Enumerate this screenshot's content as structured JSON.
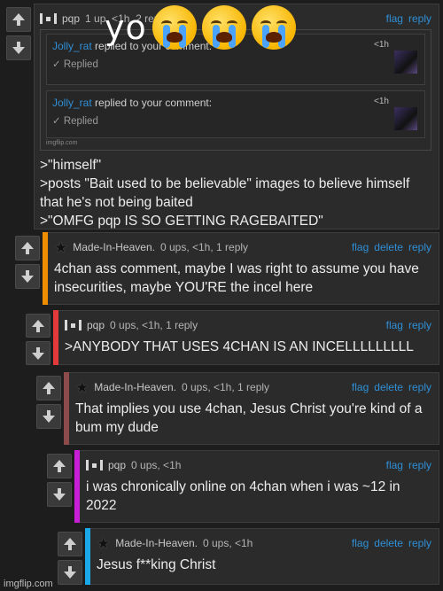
{
  "caption": {
    "text": "yo",
    "emoji_count": 3,
    "emoji_name": "loudly-crying-face"
  },
  "colors": {
    "accent_link": "#2f8fd6",
    "bar_orange": "#f08c00",
    "bar_red": "#e23a3a",
    "bar_brown": "#8c4a4a",
    "bar_magenta": "#c81ed6",
    "bar_cyan": "#1aa8e8"
  },
  "comments": [
    {
      "user": "pqp",
      "stats": "1 up, <1h, 2 replies",
      "actions": [
        "flag",
        "reply"
      ],
      "embed": {
        "notifications": [
          {
            "who": "Jolly_rat",
            "text": " replied to your comment:",
            "time": "<1h",
            "status": "Replied"
          },
          {
            "who": "Jolly_rat",
            "text": " replied to your comment:",
            "time": "<1h",
            "status": "Replied"
          }
        ],
        "watermark": "imgflip.com"
      },
      "lines": [
        ">\"himself\"",
        ">posts \"Bait used to be believable\" images to believe himself that he's not being baited",
        ">\"OMFG pqp IS SO GETTING RAGEBAITED\""
      ]
    },
    {
      "user": "Made-In-Heaven.",
      "stats": "0 ups, <1h, 1 reply",
      "actions": [
        "flag",
        "delete",
        "reply"
      ],
      "text": "4chan ass comment, maybe I was right to assume you have insecurities, maybe YOU'RE the incel here"
    },
    {
      "user": "pqp",
      "stats": "0 ups, <1h, 1 reply",
      "actions": [
        "flag",
        "reply"
      ],
      "text": ">ANYBODY THAT USES 4CHAN IS AN INCELLLLLLLLL"
    },
    {
      "user": "Made-In-Heaven.",
      "stats": "0 ups, <1h, 1 reply",
      "actions": [
        "flag",
        "delete",
        "reply"
      ],
      "text": "That implies you use 4chan, Jesus Christ you're kind of a bum my dude"
    },
    {
      "user": "pqp",
      "stats": "0 ups, <1h",
      "actions": [
        "flag",
        "reply"
      ],
      "text": "i was chronically online on 4chan when i was ~12 in 2022"
    },
    {
      "user": "Made-In-Heaven.",
      "stats": "0 ups, <1h",
      "actions": [
        "flag",
        "delete",
        "reply"
      ],
      "text": "Jesus f**king Christ"
    }
  ],
  "watermark": "imgflip.com"
}
